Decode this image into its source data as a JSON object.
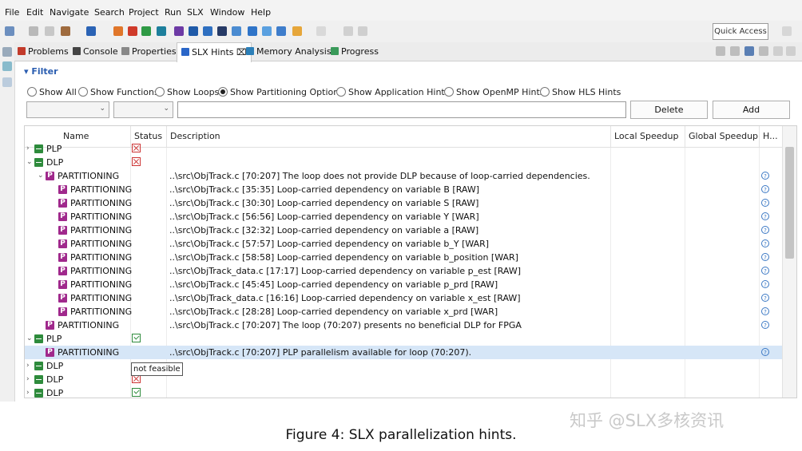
{
  "menu": [
    "File",
    "Edit",
    "Navigate",
    "Search",
    "Project",
    "Run",
    "SLX",
    "Window",
    "Help"
  ],
  "toolbar": {
    "quick_access": "Quick Access"
  },
  "tabs": [
    {
      "label": "Problems"
    },
    {
      "label": "Console"
    },
    {
      "label": "Properties"
    },
    {
      "label": "SLX Hints ⌧"
    },
    {
      "label": "Memory Analysis"
    },
    {
      "label": "Progress"
    }
  ],
  "filter": {
    "header": "▾ Filter",
    "radios": [
      {
        "label": "Show All",
        "checked": false
      },
      {
        "label": "Show Functions",
        "checked": false
      },
      {
        "label": "Show Loops",
        "checked": false
      },
      {
        "label": "Show Partitioning Options",
        "checked": true
      },
      {
        "label": "Show Application Hints",
        "checked": false
      },
      {
        "label": "Show OpenMP Hints",
        "checked": false
      },
      {
        "label": "Show HLS Hints",
        "checked": false
      }
    ],
    "combo_arrow": "⌄",
    "delete_label": "Delete",
    "add_label": "Add"
  },
  "table": {
    "columns": [
      "Name",
      "Status",
      "Description",
      "Local Speedup",
      "Global Speedup",
      "H..."
    ],
    "rows": [
      {
        "twisty": "›",
        "icon": "g",
        "name": "PLP",
        "status": "x",
        "desc": "",
        "help": false
      },
      {
        "twisty": "⌄",
        "icon": "g",
        "name": "DLP",
        "status": "x",
        "desc": "",
        "help": false
      },
      {
        "twisty": "⌄",
        "icon": "p",
        "name": "PARTITIONING",
        "status": "",
        "desc": "..\\src\\ObjTrack.c [70:207]  The loop does not provide DLP because of loop-carried dependencies.",
        "help": true
      },
      {
        "twisty": "",
        "icon": "p",
        "name": "PARTITIONING",
        "status": "",
        "desc": "..\\src\\ObjTrack.c [35:35]  Loop-carried dependency on variable B [RAW]",
        "help": true
      },
      {
        "twisty": "",
        "icon": "p",
        "name": "PARTITIONING",
        "status": "",
        "desc": "..\\src\\ObjTrack.c [30:30]  Loop-carried dependency on variable S [RAW]",
        "help": true
      },
      {
        "twisty": "",
        "icon": "p",
        "name": "PARTITIONING",
        "status": "",
        "desc": "..\\src\\ObjTrack.c [56:56]  Loop-carried dependency on variable Y [WAR]",
        "help": true
      },
      {
        "twisty": "",
        "icon": "p",
        "name": "PARTITIONING",
        "status": "",
        "desc": "..\\src\\ObjTrack.c [32:32]  Loop-carried dependency on variable a [RAW]",
        "help": true
      },
      {
        "twisty": "",
        "icon": "p",
        "name": "PARTITIONING",
        "status": "",
        "desc": "..\\src\\ObjTrack.c [57:57]  Loop-carried dependency on variable b_Y [WAR]",
        "help": true
      },
      {
        "twisty": "",
        "icon": "p",
        "name": "PARTITIONING",
        "status": "",
        "desc": "..\\src\\ObjTrack.c [58:58]  Loop-carried dependency on variable b_position [WAR]",
        "help": true
      },
      {
        "twisty": "",
        "icon": "p",
        "name": "PARTITIONING",
        "status": "",
        "desc": "..\\src\\ObjTrack_data.c [17:17]  Loop-carried dependency on variable p_est [RAW]",
        "help": true
      },
      {
        "twisty": "",
        "icon": "p",
        "name": "PARTITIONING",
        "status": "",
        "desc": "..\\src\\ObjTrack.c [45:45]  Loop-carried dependency on variable p_prd [RAW]",
        "help": true
      },
      {
        "twisty": "",
        "icon": "p",
        "name": "PARTITIONING",
        "status": "",
        "desc": "..\\src\\ObjTrack_data.c [16:16]  Loop-carried dependency on variable x_est [RAW]",
        "help": true
      },
      {
        "twisty": "",
        "icon": "p",
        "name": "PARTITIONING",
        "status": "",
        "desc": "..\\src\\ObjTrack.c [28:28]  Loop-carried dependency on variable x_prd [WAR]",
        "help": true
      },
      {
        "twisty": "",
        "icon": "p",
        "name": "PARTITIONING",
        "status": "",
        "desc": "..\\src\\ObjTrack.c [70:207]  The loop (70:207) presents no beneficial DLP for FPGA",
        "help": true
      },
      {
        "twisty": "⌄",
        "icon": "g",
        "name": "PLP",
        "status": "ok",
        "desc": "",
        "help": false
      },
      {
        "twisty": "",
        "icon": "p",
        "name": "PARTITIONING",
        "status": "",
        "desc": "..\\src\\ObjTrack.c [70:207]  PLP parallelism available for loop (70:207).",
        "help": true,
        "selected": true
      },
      {
        "twisty": "›",
        "icon": "g",
        "name": "DLP",
        "status": "",
        "desc": "",
        "help": false
      },
      {
        "twisty": "›",
        "icon": "g",
        "name": "DLP",
        "status": "x",
        "desc": "",
        "help": false
      },
      {
        "twisty": "›",
        "icon": "g",
        "name": "DLP",
        "status": "ok",
        "desc": "",
        "help": false
      }
    ],
    "tooltip": "not feasible"
  },
  "caption": "Figure 4: SLX parallelization hints.",
  "watermark": "知乎 @SLX多核资讯"
}
